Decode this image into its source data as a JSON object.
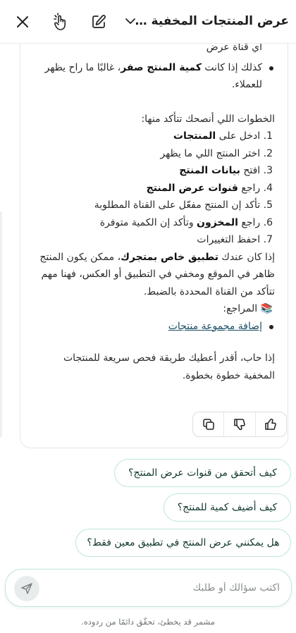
{
  "header": {
    "title": "عرض المنتجات المخفية في ...",
    "icons": {
      "close": "close-icon",
      "gesture": "touch-icon",
      "edit": "edit-icon",
      "chevron": "chevron-down-icon"
    }
  },
  "message": {
    "top_line": "أي قناة عرض",
    "bullet_quantity": {
      "prefix": "كذلك إذا كانت ",
      "bold": "كمية المنتج صفر",
      "suffix": "، غالبًا ما راح يظهر للعملاء."
    },
    "steps_intro": "الخطوات اللي أنصحك تتأكد منها:",
    "steps": [
      {
        "num": "1.",
        "text": "ادخل على ",
        "bold": "المنتجات",
        "tail": ""
      },
      {
        "num": "2.",
        "text": "اختر المنتج اللي ما يظهر",
        "bold": "",
        "tail": ""
      },
      {
        "num": "3.",
        "text": "افتح ",
        "bold": "بيانات المنتج",
        "tail": ""
      },
      {
        "num": "4.",
        "text": "راجع ",
        "bold": "قنوات عرض المنتج",
        "tail": ""
      },
      {
        "num": "5.",
        "text": "تأكد إن المنتج مفعّل على القناة المطلوبة",
        "bold": "",
        "tail": ""
      },
      {
        "num": "6.",
        "text": "راجع ",
        "bold": "المخزون",
        "tail": " وتأكد إن الكمية متوفرة"
      },
      {
        "num": "7.",
        "text": "احفظ التغييرات",
        "bold": "",
        "tail": ""
      }
    ],
    "app_note": {
      "l1_prefix": "إذا كان عندك ",
      "l1_bold": "تطبيق خاص بمتجرك",
      "l1_suffix": "، ممكن يكون المنتج",
      "l2": "ظاهر في الموقع ومخفي في التطبيق أو العكس، فهنا مهم",
      "l3": "تتأكد من القناة المحددة بالضبط."
    },
    "refs_label": "📚 المراجع:",
    "ref_link": "إضافة مجموعة منتجات",
    "closing": [
      "إذا حاب، أقدر أعطيك طريقة فحص سريعة للمنتجات",
      "المخفية خطوة بخطوة."
    ],
    "actions": {
      "copy": "copy-icon",
      "dislike": "thumbs-down-icon",
      "like": "thumbs-up-icon"
    }
  },
  "suggestions": [
    "كيف أتحقق من قنوات عرض المنتج؟",
    "كيف أضيف كمية للمنتج؟",
    "هل يمكنني عرض المنتج في تطبيق معين فقط؟"
  ],
  "input": {
    "placeholder": "اكتب سؤالك أو طلبك",
    "value": ""
  },
  "disclaimer": "مشمر قد يخطئ، تحقّق دائمًا من ردوده.",
  "colors": {
    "accent_border": "#bfe6dc",
    "link": "#1a4f66",
    "card_border": "#e3e6e6"
  }
}
